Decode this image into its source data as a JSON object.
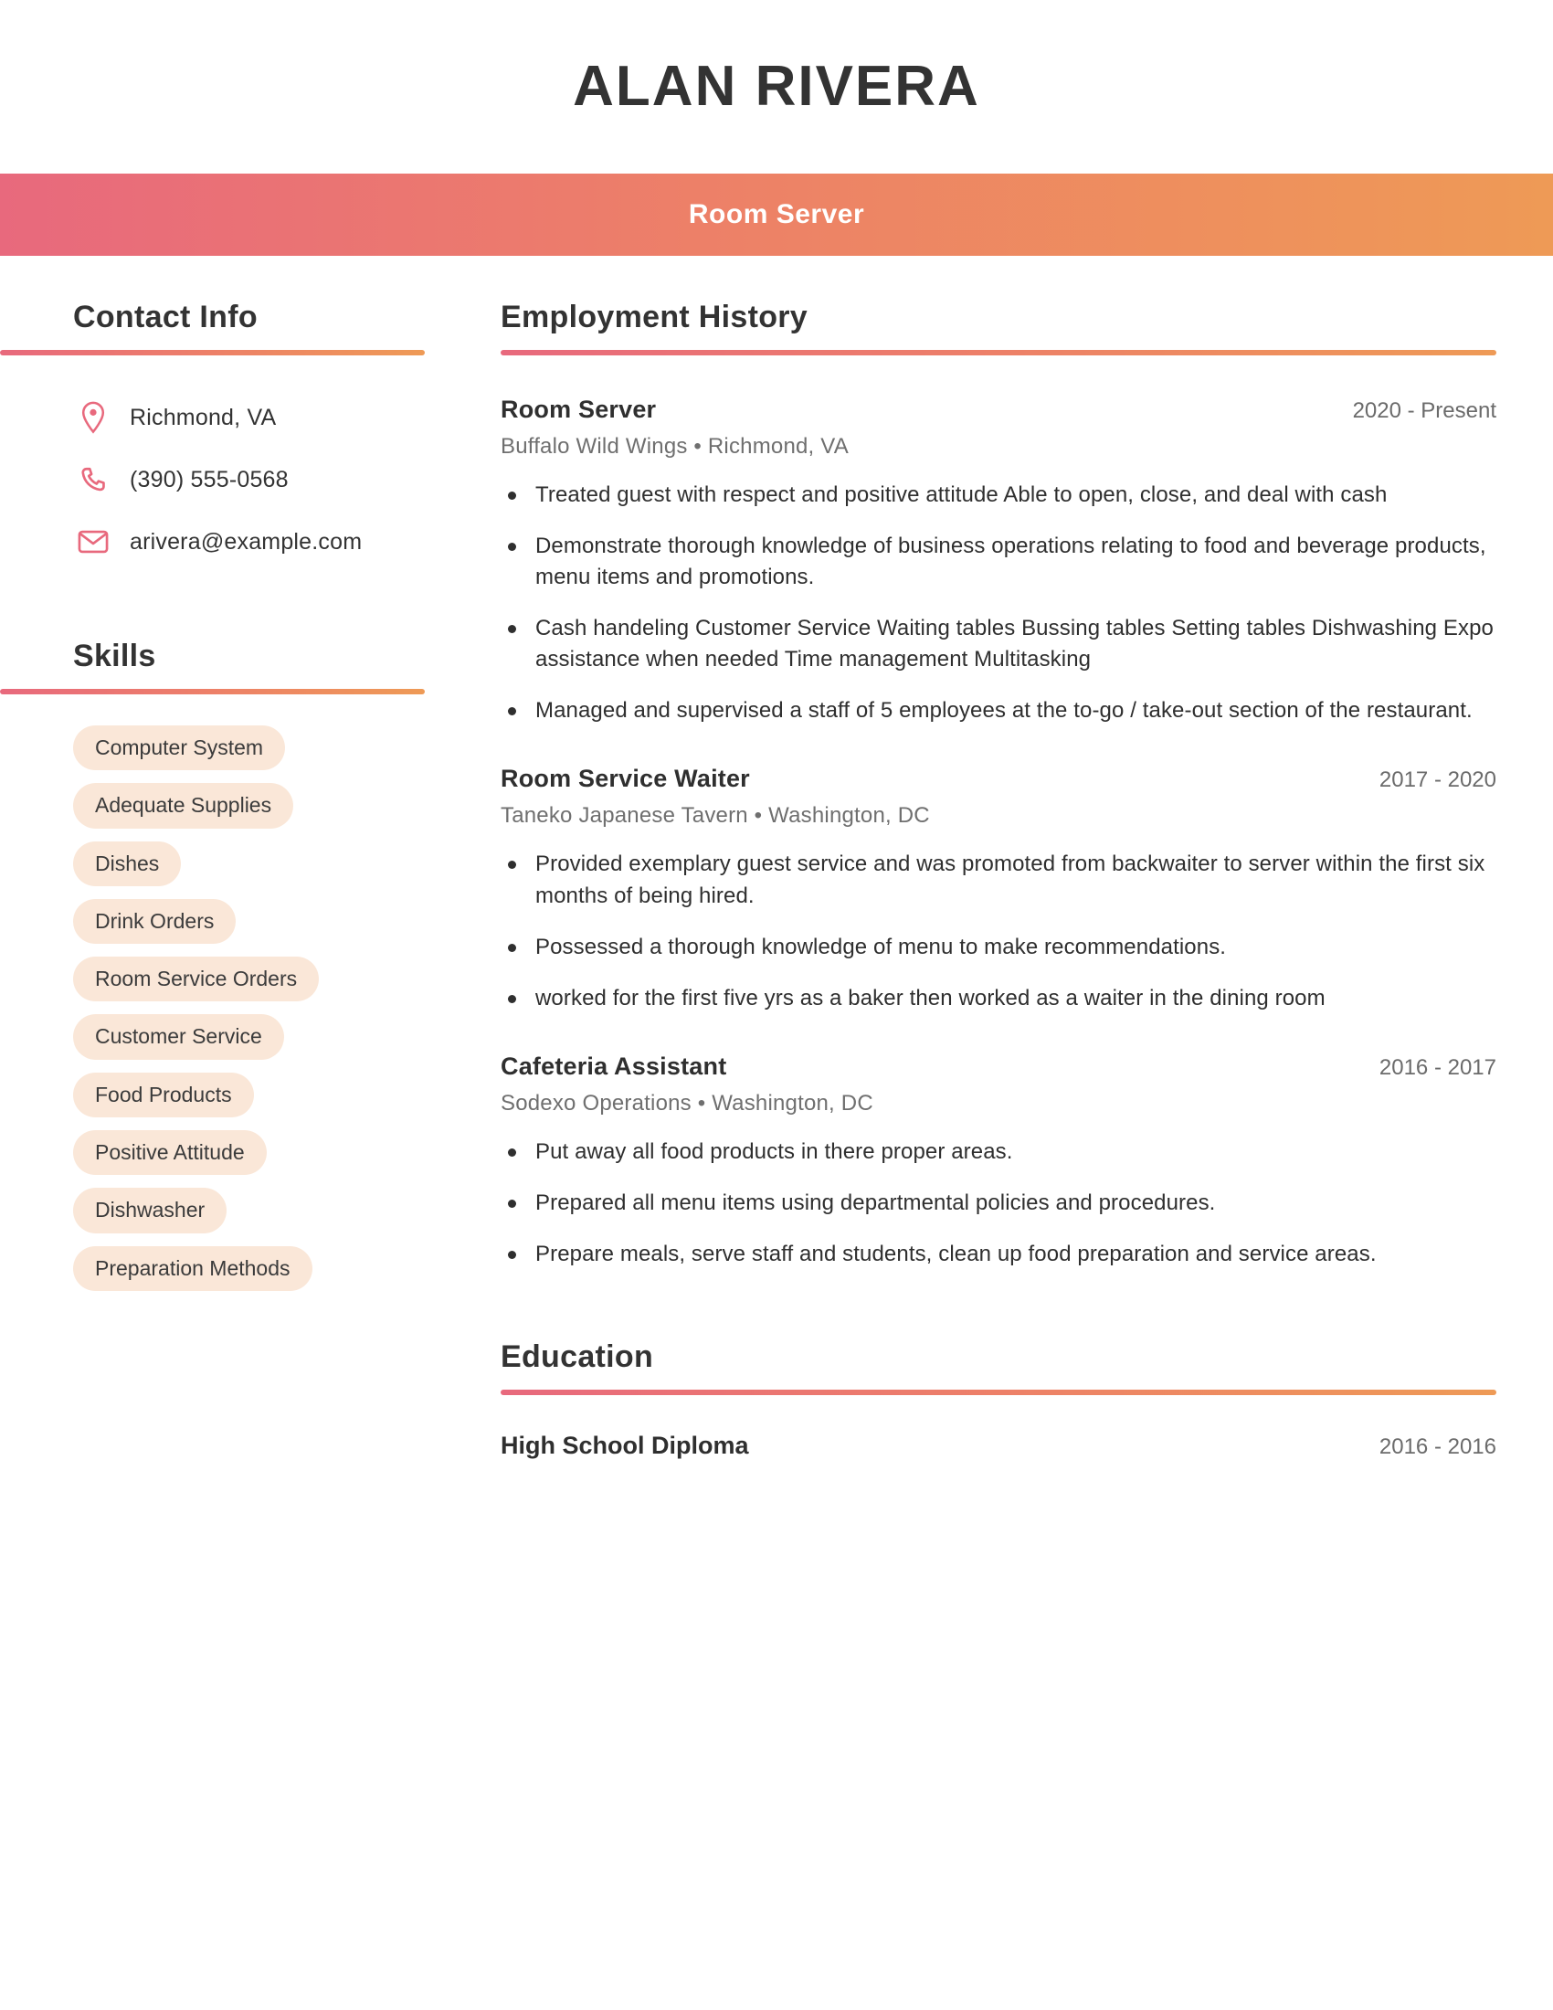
{
  "header": {
    "name": "ALAN RIVERA",
    "job_title_band": "Room Server",
    "gradient_start": "#e8697d",
    "gradient_end": "#ee9a56"
  },
  "sidebar": {
    "contact": {
      "heading": "Contact Info",
      "items": [
        {
          "icon": "location-pin-icon",
          "value": "Richmond, VA"
        },
        {
          "icon": "phone-icon",
          "value": "(390) 555-0568"
        },
        {
          "icon": "email-icon",
          "value": "arivera@example.com"
        }
      ]
    },
    "skills": {
      "heading": "Skills",
      "pill_bg": "#fae7d8",
      "items": [
        "Computer System",
        "Adequate Supplies",
        "Dishes",
        "Drink Orders",
        "Room Service Orders",
        "Customer Service",
        "Food Products",
        "Positive Attitude",
        "Dishwasher",
        "Preparation Methods"
      ]
    }
  },
  "main": {
    "employment": {
      "heading": "Employment History",
      "jobs": [
        {
          "title": "Room Server",
          "dates": "2020 - Present",
          "company": "Buffalo Wild Wings  •  Richmond, VA",
          "bullets": [
            "Treated guest with respect and positive attitude Able to open, close, and deal with cash",
            "Demonstrate thorough knowledge of business operations relating to food and beverage products, menu items and promotions.",
            "Cash handeling Customer Service Waiting tables Bussing tables Setting tables Dishwashing Expo assistance when needed Time management Multitasking",
            "Managed and supervised a staff of 5 employees at the to-go / take-out section of the restaurant."
          ]
        },
        {
          "title": "Room Service Waiter",
          "dates": "2017 - 2020",
          "company": "Taneko Japanese Tavern  •  Washington, DC",
          "bullets": [
            "Provided exemplary guest service and was promoted from backwaiter to server within the first six months of being hired.",
            "Possessed a thorough knowledge of menu to make recommendations.",
            "worked for the first five yrs as a baker then worked as a waiter in the dining room"
          ]
        },
        {
          "title": "Cafeteria Assistant",
          "dates": "2016 - 2017",
          "company": "Sodexo Operations  •  Washington, DC",
          "bullets": [
            "Put away all food products in there proper areas.",
            "Prepared all menu items using departmental policies and procedures.",
            "Prepare meals, serve staff and students, clean up food preparation and service areas."
          ]
        }
      ]
    },
    "education": {
      "heading": "Education",
      "entries": [
        {
          "degree": "High School Diploma",
          "dates": "2016 - 2016"
        }
      ]
    }
  }
}
